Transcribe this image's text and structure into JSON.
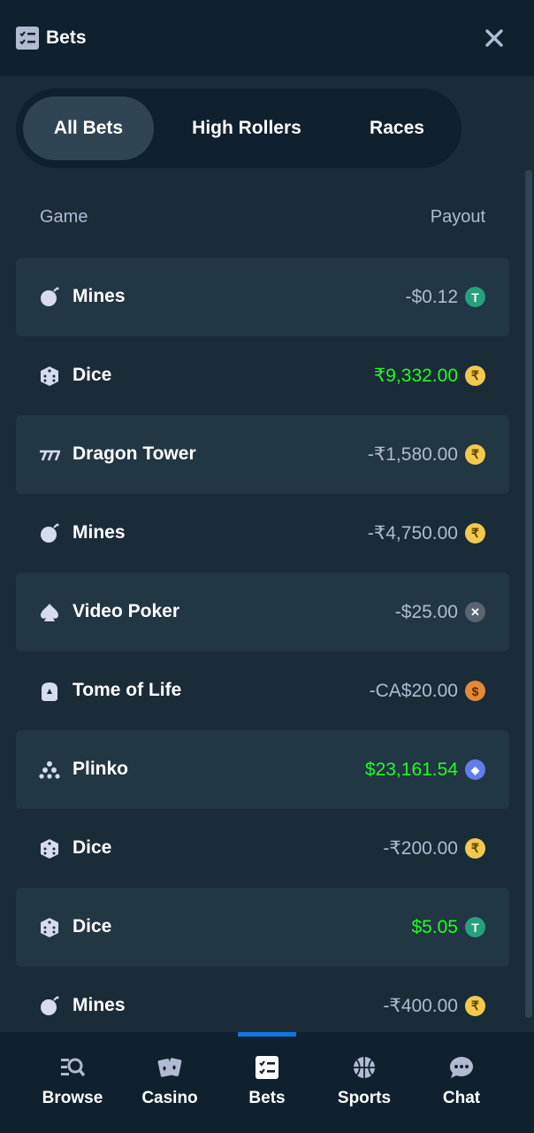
{
  "header": {
    "title": "Bets",
    "icon": "bets-icon",
    "close_icon": "close-icon"
  },
  "tabs": [
    {
      "label": "All Bets",
      "active": true
    },
    {
      "label": "High Rollers",
      "active": false
    },
    {
      "label": "Races",
      "active": false
    }
  ],
  "table": {
    "columns": {
      "game": "Game",
      "payout": "Payout"
    },
    "rows": [
      {
        "game": "Mines",
        "icon": "mines-icon",
        "payout": "-$0.12",
        "win": false,
        "coin": "usdt-coin-icon",
        "coin_color": "#26a17b",
        "coin_glyph": "T"
      },
      {
        "game": "Dice",
        "icon": "dice-icon",
        "payout": "₹9,332.00",
        "win": true,
        "coin": "inr-coin-icon",
        "coin_color": "#f2c94c",
        "coin_glyph": "₹"
      },
      {
        "game": "Dragon Tower",
        "icon": "dragon-tower-icon",
        "payout": "-₹1,580.00",
        "win": false,
        "coin": "inr-coin-icon",
        "coin_color": "#f2c94c",
        "coin_glyph": "₹"
      },
      {
        "game": "Mines",
        "icon": "mines-icon",
        "payout": "-₹4,750.00",
        "win": false,
        "coin": "inr-coin-icon",
        "coin_color": "#f2c94c",
        "coin_glyph": "₹"
      },
      {
        "game": "Video Poker",
        "icon": "spade-icon",
        "payout": "-$25.00",
        "win": false,
        "coin": "xrp-coin-icon",
        "coin_color": "#5a6570",
        "coin_glyph": "✕"
      },
      {
        "game": "Tome of Life",
        "icon": "tome-of-life-icon",
        "payout": "-CA$20.00",
        "win": false,
        "coin": "cad-coin-icon",
        "coin_color": "#e08a3a",
        "coin_glyph": "$"
      },
      {
        "game": "Plinko",
        "icon": "plinko-icon",
        "payout": "$23,161.54",
        "win": true,
        "coin": "eth-coin-icon",
        "coin_color": "#627eea",
        "coin_glyph": "◆"
      },
      {
        "game": "Dice",
        "icon": "dice-icon",
        "payout": "-₹200.00",
        "win": false,
        "coin": "inr-coin-icon",
        "coin_color": "#f2c94c",
        "coin_glyph": "₹"
      },
      {
        "game": "Dice",
        "icon": "dice-icon",
        "payout": "$5.05",
        "win": true,
        "coin": "usdt-coin-icon",
        "coin_color": "#26a17b",
        "coin_glyph": "T"
      },
      {
        "game": "Mines",
        "icon": "mines-icon",
        "payout": "-₹400.00",
        "win": false,
        "coin": "inr-coin-icon",
        "coin_color": "#f2c94c",
        "coin_glyph": "₹"
      }
    ]
  },
  "bottom_nav": {
    "items": [
      {
        "label": "Browse",
        "icon": "browse-icon",
        "active": false
      },
      {
        "label": "Casino",
        "icon": "casino-cards-icon",
        "active": false
      },
      {
        "label": "Bets",
        "icon": "bets-icon",
        "active": true
      },
      {
        "label": "Sports",
        "icon": "basketball-icon",
        "active": false
      },
      {
        "label": "Chat",
        "icon": "chat-icon",
        "active": false
      }
    ]
  },
  "colors": {
    "background": "#1a2c38",
    "header": "#0f212e",
    "row_shaded": "#213743",
    "tab_active": "#2f4553",
    "text_muted": "#b1bad3",
    "win_green": "#1fff20",
    "accent_blue": "#1475e1"
  }
}
